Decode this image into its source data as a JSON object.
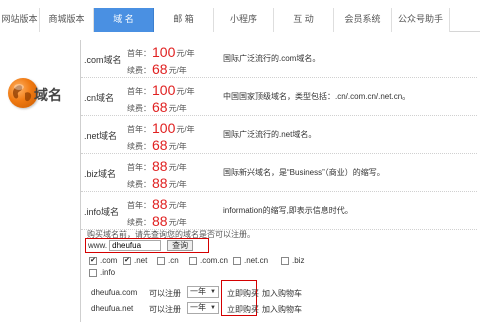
{
  "tabs": [
    {
      "label": "网站版本",
      "active": false
    },
    {
      "label": "商城版本",
      "active": false
    },
    {
      "label": "域  名",
      "active": true
    },
    {
      "label": "邮  箱",
      "active": false
    },
    {
      "label": "小程序",
      "active": false
    },
    {
      "label": "互  动",
      "active": false
    },
    {
      "label": "会员系统",
      "active": false
    },
    {
      "label": "公众号助手",
      "active": false
    }
  ],
  "logo": {
    "text": "域名",
    "icon": "globe-icon"
  },
  "pricing": {
    "first_year_label": "首年：",
    "renew_label": "续费：",
    "unit": "元/年",
    "rows": [
      {
        "domain": ".com域名",
        "first": "100",
        "renew": "68",
        "desc": "国际广泛流行的.com域名。"
      },
      {
        "domain": ".cn域名",
        "first": "100",
        "renew": "68",
        "desc": "中国国家顶级域名，类型包括：.cn/.com.cn/.net.cn。"
      },
      {
        "domain": ".net域名",
        "first": "100",
        "renew": "68",
        "desc": "国际广泛流行的.net域名。"
      },
      {
        "domain": ".biz域名",
        "first": "88",
        "renew": "88",
        "desc": "国际新兴域名，是“Business”（商业）的缩写。"
      },
      {
        "domain": ".info域名",
        "first": "88",
        "renew": "88",
        "desc": "information的缩写,即表示信息时代。"
      }
    ]
  },
  "search": {
    "hint": "购买域名前，请先查询您的域名是否可以注册。",
    "prefix": "www.",
    "value": "dheufua",
    "button": "查询"
  },
  "tlds": [
    {
      "label": ".com",
      "checked": true
    },
    {
      "label": ".net",
      "checked": true
    },
    {
      "label": ".cn",
      "checked": false
    },
    {
      "label": ".com.cn",
      "checked": false
    },
    {
      "label": ".net.cn",
      "checked": false
    },
    {
      "label": ".biz",
      "checked": false
    },
    {
      "label": ".info",
      "checked": false
    }
  ],
  "results": [
    {
      "domain": "dheufua.com",
      "status": "可以注册",
      "period": "一年",
      "buy": "立即购买",
      "cart": "加入购物车"
    },
    {
      "domain": "dheufua.net",
      "status": "可以注册",
      "period": "一年",
      "buy": "立即购买",
      "cart": "加入购物车"
    }
  ],
  "colors": {
    "accent": "#4a90e2",
    "price": "#e02020",
    "highlight_border": "#d40000"
  }
}
